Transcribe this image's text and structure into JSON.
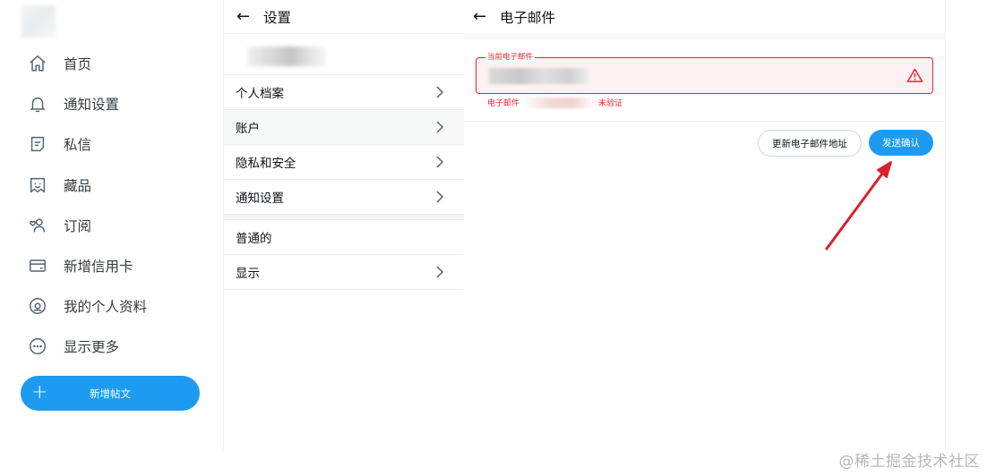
{
  "nav": {
    "items": [
      {
        "label": "首页",
        "icon": "home-icon"
      },
      {
        "label": "通知设置",
        "icon": "bell-icon"
      },
      {
        "label": "私信",
        "icon": "message-icon"
      },
      {
        "label": "藏品",
        "icon": "collection-icon"
      },
      {
        "label": "订阅",
        "icon": "subscription-icon"
      },
      {
        "label": "新增信用卡",
        "icon": "credit-card-icon"
      },
      {
        "label": "我的个人资料",
        "icon": "profile-icon"
      },
      {
        "label": "显示更多",
        "icon": "more-icon"
      }
    ],
    "new_post": {
      "plus": "+",
      "label": "新增帖文"
    }
  },
  "settings": {
    "back": "←",
    "title": "设置",
    "items": [
      {
        "label": "个人档案",
        "chevron": true
      },
      {
        "label": "账户",
        "chevron": true,
        "active": true
      },
      {
        "label": "隐私和安全",
        "chevron": true
      },
      {
        "label": "通知设置",
        "chevron": true
      }
    ],
    "items2": [
      {
        "label": "普通的",
        "chevron": false
      },
      {
        "label": "显示",
        "chevron": true
      }
    ]
  },
  "email": {
    "back": "←",
    "title": "电子邮件",
    "field_label": "当前电子邮件",
    "error_prefix": "电子邮件",
    "error_suffix": "未验证",
    "update_button": "更新电子邮件地址",
    "send_button": "发送确认"
  },
  "colors": {
    "accent": "#1d9bf0",
    "error": "#f4212e",
    "arrow": "#d9222a"
  },
  "watermark": "@稀土掘金技术社区"
}
